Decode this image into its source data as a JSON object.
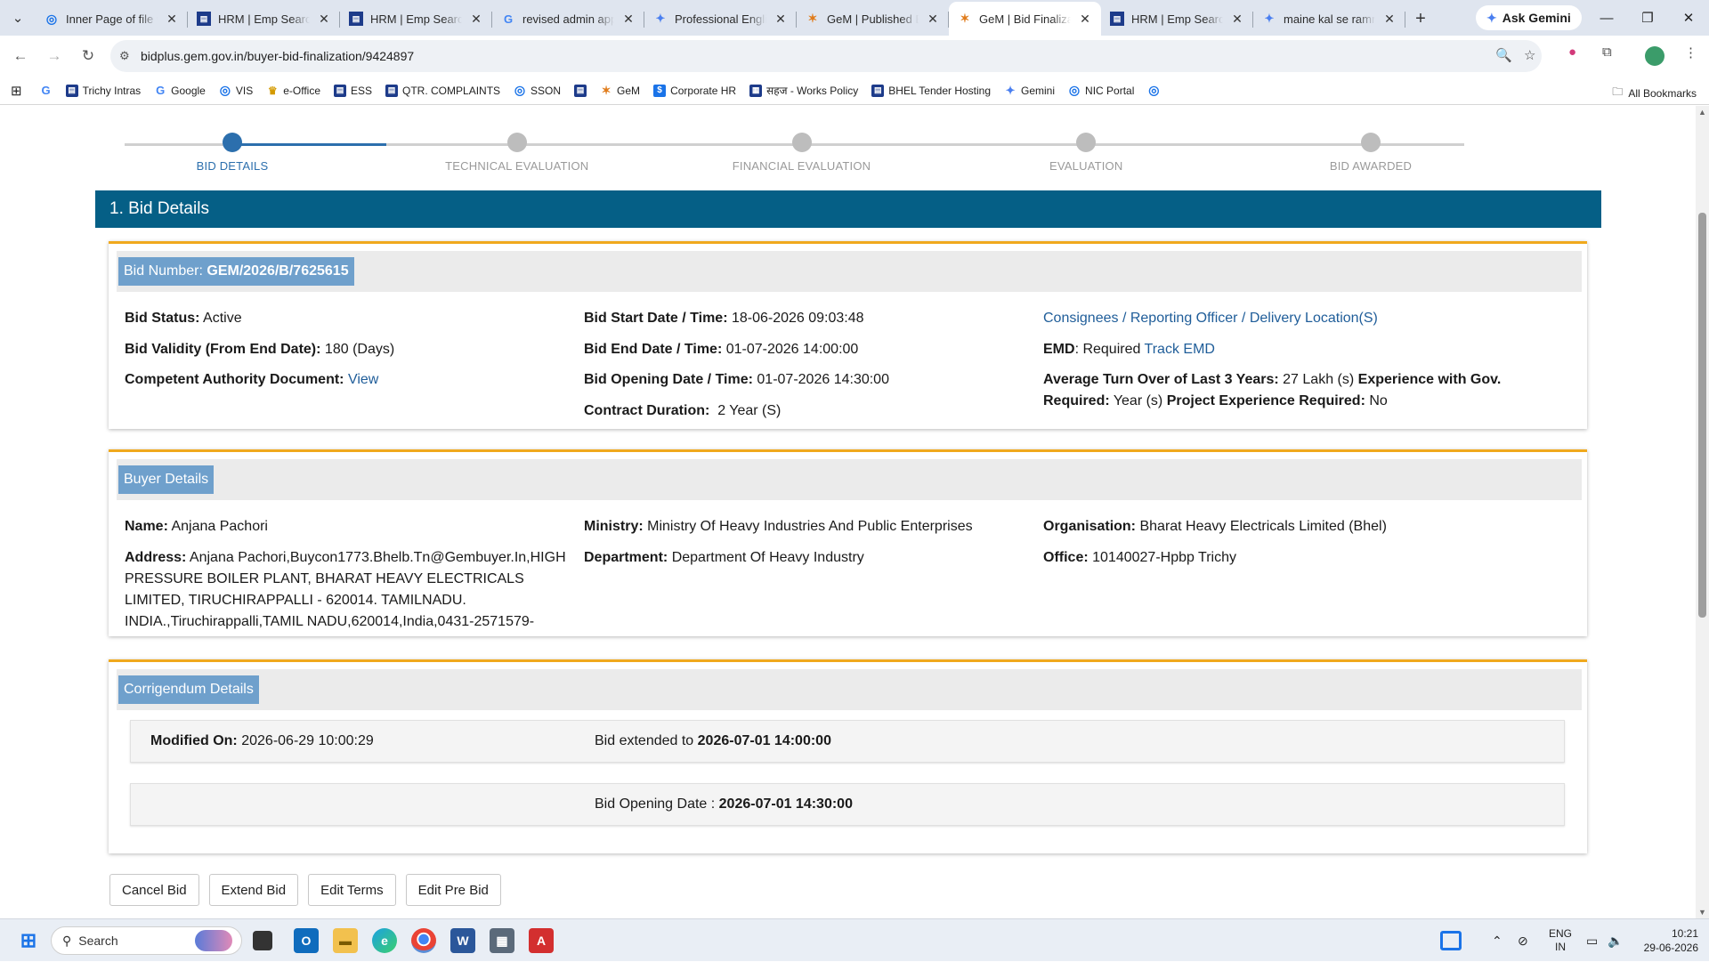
{
  "browser": {
    "tabs": [
      {
        "title": "Inner Page of file v",
        "favicon": "globe-icon",
        "active": false
      },
      {
        "title": "HRM | Emp Search",
        "favicon": "bhel-logo-icon",
        "active": false
      },
      {
        "title": "HRM | Emp Search",
        "favicon": "bhel-logo-icon",
        "active": false
      },
      {
        "title": "revised admin app",
        "favicon": "google-icon",
        "active": false
      },
      {
        "title": "Professional English",
        "favicon": "gemini-icon",
        "active": false
      },
      {
        "title": "GeM | Published B",
        "favicon": "gem-icon",
        "active": false
      },
      {
        "title": "GeM | Bid Finalizat",
        "favicon": "gem-icon",
        "active": true
      },
      {
        "title": "HRM | Emp Search",
        "favicon": "bhel-logo-icon",
        "active": false
      },
      {
        "title": "maine kal se ramr",
        "favicon": "gemini-icon",
        "active": false
      }
    ],
    "ask_gemini": "Ask Gemini",
    "url": "bidplus.gem.gov.in/buyer-bid-finalization/9424897",
    "bookmarks": [
      {
        "label": "",
        "icon": "google-icon"
      },
      {
        "label": "Trichy Intras",
        "icon": "bhel-logo-icon"
      },
      {
        "label": "Google",
        "icon": "google-icon"
      },
      {
        "label": "VIS",
        "icon": "globe-icon"
      },
      {
        "label": "e-Office",
        "icon": "eoffice-icon"
      },
      {
        "label": "ESS",
        "icon": "bhel-logo-icon"
      },
      {
        "label": "QTR. COMPLAINTS",
        "icon": "bhel-logo-icon"
      },
      {
        "label": "SSON",
        "icon": "globe-icon"
      },
      {
        "label": "",
        "icon": "bhel-logo-icon"
      },
      {
        "label": "GeM",
        "icon": "gem-icon"
      },
      {
        "label": "Corporate HR",
        "icon": "corporate-hr-icon"
      },
      {
        "label": "सहज - Works Policy",
        "icon": "document-icon"
      },
      {
        "label": "BHEL Tender Hosting",
        "icon": "bhel-logo-icon"
      },
      {
        "label": "Gemini",
        "icon": "gemini-icon"
      },
      {
        "label": "NIC Portal",
        "icon": "globe-icon"
      },
      {
        "label": "",
        "icon": "globe-icon"
      }
    ],
    "all_bookmarks": "All Bookmarks"
  },
  "stepper": {
    "steps": [
      "BID DETAILS",
      "TECHNICAL EVALUATION",
      "FINANCIAL EVALUATION",
      "EVALUATION",
      "BID AWARDED"
    ],
    "active_index": 0,
    "accent": "#2c6fad"
  },
  "section_title": "1. Bid Details",
  "bid": {
    "number_label": "Bid Number: ",
    "number": "GEM/2026/B/7625615",
    "status_label": "Bid Status:",
    "status": "Active",
    "validity_label": "Bid Validity (From End Date):",
    "validity": "180 (Days)",
    "authority_label": "Competent Authority Document:",
    "authority_link": "View",
    "start_label": "Bid Start Date / Time:",
    "start": "18-06-2026 09:03:48",
    "end_label": "Bid End Date / Time:",
    "end": "01-07-2026 14:00:00",
    "opening_label": "Bid Opening Date / Time:",
    "opening": "01-07-2026 14:30:00",
    "duration_label": "Contract Duration:",
    "duration": "2 Year (S)",
    "consignees_link": "Consignees / Reporting Officer / Delivery Location(S)",
    "emd_label": "EMD",
    "emd": ": Required",
    "track_emd": "Track EMD",
    "turnover_label": "Average Turn Over of Last 3 Years:",
    "turnover": "27 Lakh (s)",
    "exp_gov_label": "Experience with Gov. Required:",
    "exp_gov": "Year (s)",
    "proj_exp_label": "Project Experience Required:",
    "proj_exp": "No"
  },
  "buyer": {
    "header": "Buyer Details",
    "name_label": "Name:",
    "name": "Anjana Pachori",
    "address_label": "Address:",
    "address": "Anjana Pachori,Buycon1773.Bhelb.Tn@Gembuyer.In,HIGH PRESSURE BOILER PLANT, BHARAT HEAVY ELECTRICALS LIMITED, TIRUCHIRAPPALLI - 620014. TAMILNADU. INDIA.,Tiruchirappalli,TAMIL NADU,620014,India,0431-2571579-",
    "ministry_label": "Ministry:",
    "ministry": "Ministry Of Heavy Industries And Public Enterprises",
    "department_label": "Department:",
    "department": "Department Of Heavy Industry",
    "organisation_label": "Organisation:",
    "organisation": "Bharat Heavy Electricals Limited (Bhel)",
    "office_label": "Office:",
    "office": "10140027-Hpbp Trichy"
  },
  "corrigendum": {
    "header": "Corrigendum Details",
    "modified_label": "Modified On:",
    "modified": "2026-06-29 10:00:29",
    "extended_label": "Bid extended to ",
    "extended": "2026-07-01 14:00:00",
    "opening_label": "Bid Opening Date : ",
    "opening": "2026-07-01 14:30:00"
  },
  "actions": {
    "cancel": "Cancel Bid",
    "extend": "Extend Bid",
    "edit_terms": "Edit Terms",
    "edit_pre_bid": "Edit Pre Bid"
  },
  "taskbar": {
    "search_placeholder": "Search",
    "lang_line1": "ENG",
    "lang_line2": "IN",
    "time": "10:21",
    "date": "29-06-2026"
  },
  "colors": {
    "section_header": "#055f86",
    "panel_accent": "#f0a91d",
    "badge": "#6fa0cc",
    "link": "#1f5d99"
  }
}
